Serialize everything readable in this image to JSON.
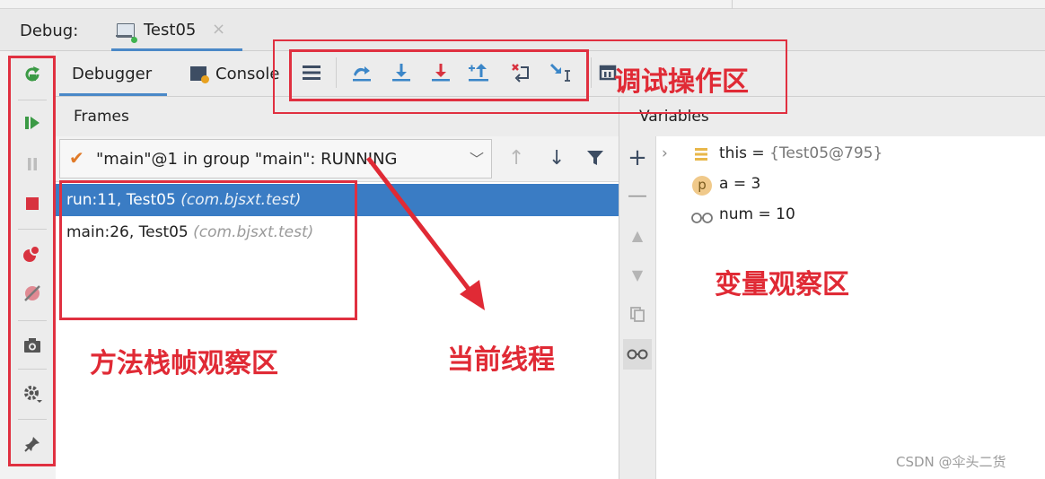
{
  "header": {
    "debug_label": "Debug:",
    "session_tab": "Test05",
    "session_close": "×"
  },
  "tabs": {
    "debugger": "Debugger",
    "console": "Console"
  },
  "action_icons": [
    "menu-lines-icon",
    "show-execution-point-icon",
    "step-over-icon",
    "step-into-icon",
    "force-step-into-icon",
    "step-out-icon",
    "drop-frame-icon",
    "run-to-cursor-icon",
    "evaluate-expression-icon"
  ],
  "left_toolbar_icons": [
    "rerun-icon",
    "resume-icon",
    "pause-icon",
    "stop-icon",
    "view-breakpoints-icon",
    "mute-breakpoints-icon",
    "camera-icon",
    "settings-icon",
    "pin-icon"
  ],
  "frames": {
    "header": "Frames",
    "thread_label": "\"main\"@1 in group \"main\": RUNNING",
    "rows": [
      {
        "method": "run:11, Test05",
        "package": "(com.bjsxt.test)",
        "selected": true
      },
      {
        "method": "main:26, Test05",
        "package": "(com.bjsxt.test)",
        "selected": false
      }
    ]
  },
  "variables": {
    "header": "Variables",
    "rows": [
      {
        "name": "this",
        "eq": " = ",
        "value": "{Test05@795}",
        "expandable": true,
        "badge": "field-lines-icon"
      },
      {
        "name": "a",
        "eq": " = ",
        "value": "3",
        "expandable": false,
        "badge": "parameter-p-icon",
        "badge_text": "p"
      },
      {
        "name": "num",
        "eq": " = ",
        "value": "10",
        "expandable": false,
        "badge": "watch-glasses-icon"
      }
    ]
  },
  "annotations": {
    "debug_ops_area": "调试操作区",
    "variables_area": "变量观察区",
    "frames_area": "方法栈帧观察区",
    "current_thread": "当前线程"
  },
  "watermark": "CSDN @伞头二货",
  "colors": {
    "accent_blue": "#4a88c7",
    "selection_blue": "#3a7cc4",
    "annotation_red": "#e02a35",
    "run_green": "#3fb34f",
    "stop_red": "#d8323f"
  }
}
